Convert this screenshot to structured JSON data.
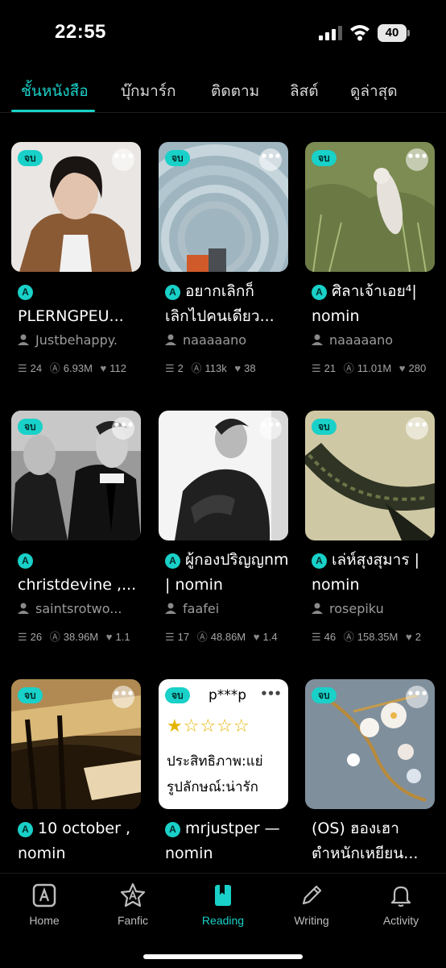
{
  "status": {
    "time": "22:55",
    "battery": "40"
  },
  "tabs": [
    {
      "label": "ชั้นหนังสือ",
      "active": true
    },
    {
      "label": "บุ๊กมาร์ก"
    },
    {
      "label": "ติดตาม"
    },
    {
      "label": "ลิสต์"
    },
    {
      "label": "ดูล่าสุด"
    }
  ],
  "badge_label": "จบ",
  "more_label": "•••",
  "books": [
    {
      "title_line1": "",
      "title_line2": "PLERNGPEU...",
      "author": "Justbehappy.",
      "chapters": "24",
      "reads": "6.93M",
      "likes": "112",
      "badge": true,
      "cover": "portrait-brown-jacket"
    },
    {
      "title_line1": "อยากเลิกก็",
      "title_line2": "เลิกไปคนเดียว...",
      "author": "naaaaano",
      "chapters": "2",
      "reads": "113k",
      "likes": "38",
      "badge": true,
      "cover": "concrete-arches"
    },
    {
      "title_line1": "ศิลาเจ้าเอย⁴|",
      "title_line2": "nomin",
      "author": "naaaaano",
      "chapters": "21",
      "reads": "11.01M",
      "likes": "280",
      "badge": true,
      "cover": "white-ferret-grass"
    },
    {
      "title_line1": "",
      "title_line2": "christdevine ,...",
      "author": "saintsrotwo...",
      "chapters": "26",
      "reads": "38.96M",
      "likes": "1.1",
      "badge": true,
      "cover": "bw-suits"
    },
    {
      "title_line1": "ผู้กองปริญญnm",
      "title_line2": "| nomin",
      "author": "faafei",
      "chapters": "17",
      "reads": "48.86M",
      "likes": "1.4",
      "badge": false,
      "cover": "bw-man-jacket"
    },
    {
      "title_line1": "เล่ห์สุงสุมาร |",
      "title_line2": "nomin",
      "author": "rosepiku",
      "chapters": "46",
      "reads": "158.35M",
      "likes": "2",
      "badge": true,
      "cover": "crocodile-tail"
    },
    {
      "title_line1": "10 october ,",
      "title_line2": "nomin",
      "author": "",
      "badge": true,
      "cover": "sepia-train"
    },
    {
      "title_line1": "mrjustper —",
      "title_line2": "nomin",
      "author": "",
      "badge": true,
      "cover": "rating-card",
      "cover_text": {
        "top": "p***p",
        "stars": "★☆☆☆☆",
        "line1": "ประสิทธิภาพ:แย่",
        "line2": "รูปลักษณ์:น่ารัก"
      }
    },
    {
      "title_line1": "(OS) ฮองเฮา",
      "title_line2": "ตำหนักเหยียน...",
      "author": "",
      "badge": true,
      "cover": "blossom-hairpin"
    }
  ],
  "bottom_nav": [
    {
      "label": "Home",
      "icon": "home-icon"
    },
    {
      "label": "Fanfic",
      "icon": "fanfic-icon"
    },
    {
      "label": "Reading",
      "icon": "reading-icon",
      "active": true
    },
    {
      "label": "Writing",
      "icon": "writing-icon"
    },
    {
      "label": "Activity",
      "icon": "activity-icon"
    }
  ],
  "colors": {
    "accent": "#19d1c8",
    "background": "#000000",
    "muted_text": "#9b9b9b"
  }
}
